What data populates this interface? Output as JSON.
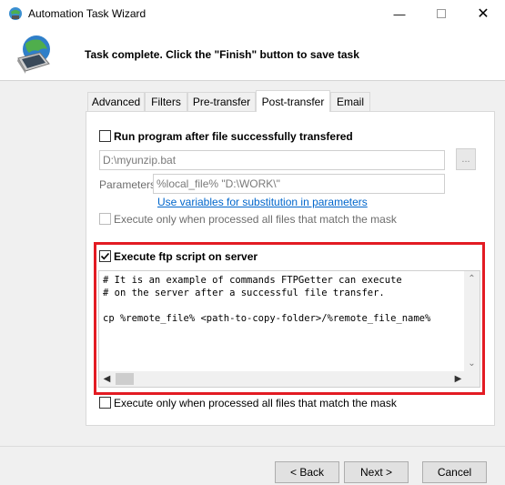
{
  "window": {
    "title": "Automation Task Wizard",
    "minimize_icon": "minimize-icon",
    "maximize_icon": "maximize-icon",
    "close_icon": "close-icon"
  },
  "header": {
    "icon": "laptop-globe-icon",
    "message": "Task complete. Click the \"Finish\" button to save task"
  },
  "tabs": [
    {
      "label": "Advanced",
      "active": false
    },
    {
      "label": "Filters",
      "active": false
    },
    {
      "label": "Pre-transfer",
      "active": false
    },
    {
      "label": "Post-transfer",
      "active": true
    },
    {
      "label": "Email",
      "active": false
    }
  ],
  "post_transfer": {
    "run_program": {
      "label": "Run program after file successfully transfered",
      "checked": false
    },
    "program_path": {
      "value": "D:\\myunzip.bat"
    },
    "browse_label": "...",
    "parameters": {
      "label": "Parameters",
      "value": "%local_file% \"D:\\WORK\\\""
    },
    "variables_link": "Use variables for substitution in parameters",
    "execute_match_mask_1": {
      "label": "Execute only when processed all files that match the mask",
      "checked": false,
      "disabled": true
    },
    "ftp_script": {
      "label": "Execute ftp script on server",
      "checked": true,
      "lines": [
        "# It is an example of commands FTPGetter can execute",
        "# on the server after a successful file transfer.",
        "",
        "cp %remote_file% <path-to-copy-folder>/%remote_file_name%"
      ]
    },
    "execute_match_mask_2": {
      "label": "Execute only when processed all files that match the mask",
      "checked": false
    }
  },
  "buttons": {
    "back": "< Back",
    "next": "Next >",
    "cancel": "Cancel"
  },
  "colors": {
    "highlight": "#e31b23",
    "link": "#0066cc"
  }
}
